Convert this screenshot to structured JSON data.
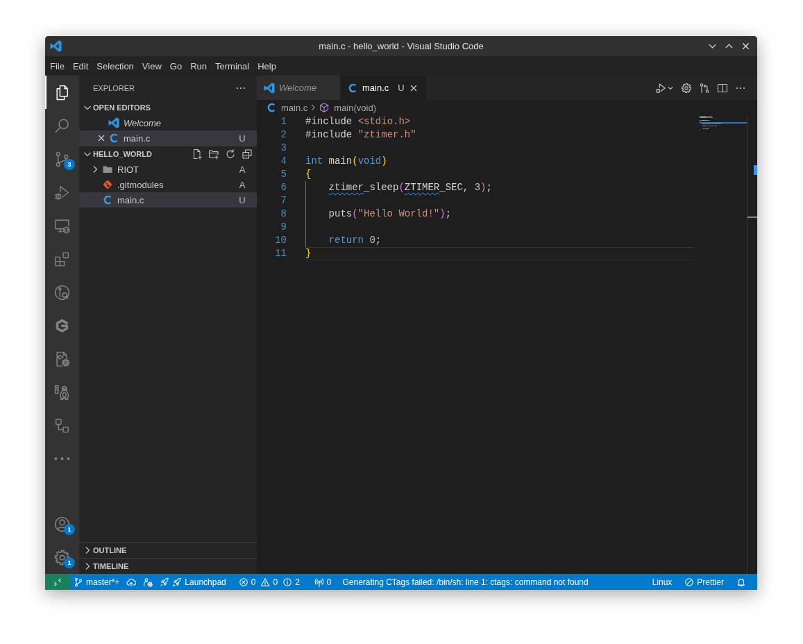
{
  "window": {
    "title": "main.c - hello_world - Visual Studio Code"
  },
  "menu": [
    "File",
    "Edit",
    "Selection",
    "View",
    "Go",
    "Run",
    "Terminal",
    "Help"
  ],
  "activity_bar": {
    "top": [
      {
        "kind": "explorer",
        "selected": true
      },
      {
        "kind": "search",
        "selected": false
      },
      {
        "kind": "scm",
        "selected": false,
        "badge": "3"
      },
      {
        "kind": "debug",
        "selected": false
      },
      {
        "kind": "remote",
        "selected": false
      },
      {
        "kind": "extensions",
        "selected": false
      },
      {
        "kind": "graph",
        "selected": false
      },
      {
        "kind": "logo",
        "selected": false
      },
      {
        "kind": "cmake",
        "selected": false
      },
      {
        "kind": "linux",
        "selected": false
      },
      {
        "kind": "flow",
        "selected": false
      },
      {
        "kind": "more",
        "selected": false
      }
    ],
    "bottom": [
      {
        "kind": "account",
        "selected": false,
        "badge": "1"
      },
      {
        "kind": "manage",
        "selected": false,
        "badge": "1"
      }
    ]
  },
  "sidebar": {
    "title": "EXPLORER",
    "sections": [
      {
        "label": "OPEN EDITORS",
        "kind": "editors",
        "expanded": true,
        "show_actions": false,
        "items": [
          {
            "label": "Welcome",
            "kind": "vscode",
            "preview": true,
            "selected": false
          },
          {
            "label": "main.c",
            "kind": "c",
            "preview": false,
            "selected": true,
            "status": "U"
          }
        ]
      },
      {
        "label": "HELLO_WORLD",
        "kind": "tree",
        "expanded": true,
        "show_actions": true,
        "items": [
          {
            "label": "RIOT",
            "kind": "folder",
            "expanded": false,
            "selected": false,
            "status": "A"
          },
          {
            "label": ".gitmodules",
            "kind": "git",
            "selected": false,
            "status": "A"
          },
          {
            "label": "main.c",
            "kind": "c",
            "selected": true,
            "status": "U"
          }
        ]
      },
      {
        "label": "OUTLINE",
        "expanded": false,
        "show_actions": false
      },
      {
        "label": "TIMELINE",
        "expanded": false,
        "show_actions": false
      }
    ]
  },
  "editor": {
    "tabs": [
      {
        "label": "Welcome",
        "kind": "vscode",
        "preview": true,
        "selected": false
      },
      {
        "label": "main.c",
        "kind": "c",
        "preview": false,
        "selected": true,
        "status": "U"
      }
    ],
    "breadcrumbs": [
      {
        "label": "main.c",
        "kind": "c"
      },
      {
        "label": "main(void)",
        "kind": "function"
      }
    ],
    "lines": [
      {
        "number": "1",
        "guide": false,
        "current": false,
        "tokens": [
          {
            "text": "#include ",
            "kind": "plain"
          },
          {
            "text": "<stdio.h>",
            "kind": "string"
          }
        ]
      },
      {
        "number": "2",
        "guide": false,
        "current": false,
        "tokens": [
          {
            "text": "#include ",
            "kind": "plain"
          },
          {
            "text": "\"ztimer.h\"",
            "kind": "string"
          }
        ]
      },
      {
        "number": "3",
        "guide": false,
        "current": false
      },
      {
        "number": "4",
        "guide": false,
        "current": false,
        "tokens": [
          {
            "text": "int ",
            "kind": "keyword"
          },
          {
            "text": "main",
            "kind": "plain"
          },
          {
            "text": "(",
            "kind": "bracket1"
          },
          {
            "text": "void",
            "kind": "keyword"
          },
          {
            "text": ")",
            "kind": "bracket1"
          }
        ]
      },
      {
        "number": "5",
        "guide": false,
        "current": false,
        "tokens": [
          {
            "text": "{",
            "kind": "bracket1"
          }
        ]
      },
      {
        "number": "6",
        "guide": true,
        "current": false,
        "tokens": [
          {
            "text": "ztimer",
            "kind": "squiggly"
          },
          {
            "text": "_sleep",
            "kind": "plain"
          },
          {
            "text": "(",
            "kind": "bracket2"
          },
          {
            "text": "ZTIMER",
            "kind": "squiggly"
          },
          {
            "text": "_SEC, ",
            "kind": "plain"
          },
          {
            "text": "3",
            "kind": "number"
          },
          {
            "text": ")",
            "kind": "bracket2"
          },
          {
            "text": ";",
            "kind": "plain"
          }
        ]
      },
      {
        "number": "7",
        "guide": true,
        "current": false
      },
      {
        "number": "8",
        "guide": true,
        "current": false,
        "tokens": [
          {
            "text": "puts",
            "kind": "plain"
          },
          {
            "text": "(",
            "kind": "bracket2"
          },
          {
            "text": "\"Hello World!\"",
            "kind": "string"
          },
          {
            "text": ")",
            "kind": "bracket2"
          },
          {
            "text": ";",
            "kind": "plain"
          }
        ]
      },
      {
        "number": "9",
        "guide": true,
        "current": false
      },
      {
        "number": "10",
        "guide": true,
        "current": false,
        "tokens": [
          {
            "text": "return ",
            "kind": "keyword"
          },
          {
            "text": "0",
            "kind": "number"
          },
          {
            "text": ";",
            "kind": "plain"
          }
        ]
      },
      {
        "number": "11",
        "guide": false,
        "current": true,
        "tokens": [
          {
            "text": "}",
            "kind": "bracket1"
          }
        ]
      }
    ]
  },
  "status_bar": {
    "left": [
      {
        "kind": "remote"
      },
      {
        "kind": "branch",
        "text": "master*+"
      },
      {
        "kind": "sync"
      },
      {
        "kind": "user"
      },
      {
        "kind": "launchpad",
        "text": "Launchpad"
      },
      {
        "kind": "problems",
        "errors": "0",
        "warnings": "0",
        "infos": "2"
      },
      {
        "kind": "ports",
        "text": "0"
      },
      {
        "kind": "message",
        "text": "Generating CTags failed: /bin/sh: line 1: ctags: command not found"
      }
    ],
    "right": [
      {
        "kind": "text",
        "text": "Linux"
      },
      {
        "kind": "prettier",
        "text": "Prettier"
      },
      {
        "kind": "bell"
      }
    ]
  }
}
